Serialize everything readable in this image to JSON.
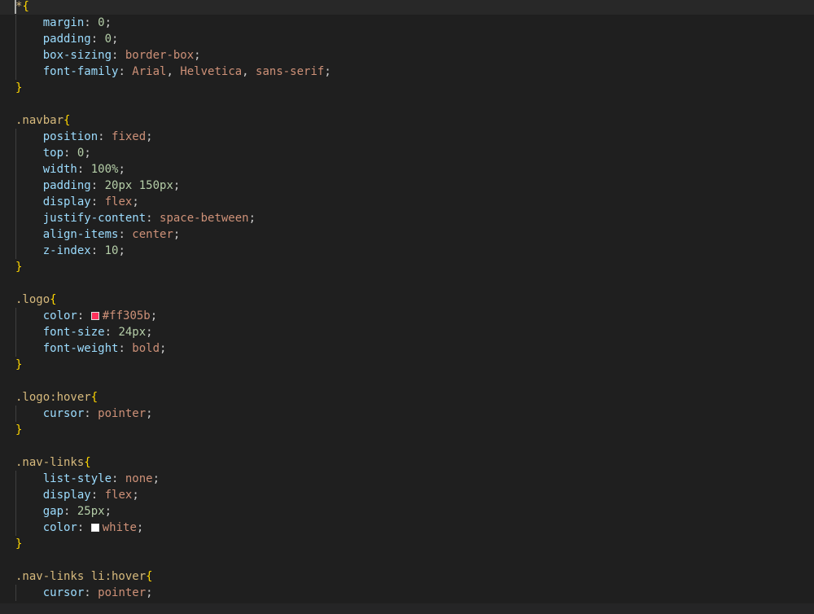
{
  "colors": {
    "background": "#1f1f1f",
    "current_line": "#282828",
    "selector": "#d7ba7d",
    "brace": "#ffd700",
    "property": "#9cdcfe",
    "value": "#ce9178",
    "number": "#b5cea8",
    "punctuation": "#cccccc"
  },
  "lines": [
    [
      {
        "t": "*",
        "c": "selector"
      },
      {
        "t": "{",
        "c": "brace"
      }
    ],
    [
      {
        "t": "    "
      },
      {
        "t": "margin",
        "c": "property"
      },
      {
        "t": ": "
      },
      {
        "t": "0",
        "c": "number"
      },
      {
        "t": ";"
      }
    ],
    [
      {
        "t": "    "
      },
      {
        "t": "padding",
        "c": "property"
      },
      {
        "t": ": "
      },
      {
        "t": "0",
        "c": "number"
      },
      {
        "t": ";"
      }
    ],
    [
      {
        "t": "    "
      },
      {
        "t": "box-sizing",
        "c": "property"
      },
      {
        "t": ": "
      },
      {
        "t": "border-box",
        "c": "value"
      },
      {
        "t": ";"
      }
    ],
    [
      {
        "t": "    "
      },
      {
        "t": "font-family",
        "c": "property"
      },
      {
        "t": ": "
      },
      {
        "t": "Arial",
        "c": "value"
      },
      {
        "t": ", "
      },
      {
        "t": "Helvetica",
        "c": "value"
      },
      {
        "t": ", "
      },
      {
        "t": "sans-serif",
        "c": "value"
      },
      {
        "t": ";"
      }
    ],
    [
      {
        "t": "}",
        "c": "brace"
      }
    ],
    [],
    [
      {
        "t": ".navbar",
        "c": "selector"
      },
      {
        "t": "{",
        "c": "brace"
      }
    ],
    [
      {
        "t": "    "
      },
      {
        "t": "position",
        "c": "property"
      },
      {
        "t": ": "
      },
      {
        "t": "fixed",
        "c": "value"
      },
      {
        "t": ";"
      }
    ],
    [
      {
        "t": "    "
      },
      {
        "t": "top",
        "c": "property"
      },
      {
        "t": ": "
      },
      {
        "t": "0",
        "c": "number"
      },
      {
        "t": ";"
      }
    ],
    [
      {
        "t": "    "
      },
      {
        "t": "width",
        "c": "property"
      },
      {
        "t": ": "
      },
      {
        "t": "100%",
        "c": "number"
      },
      {
        "t": ";"
      }
    ],
    [
      {
        "t": "    "
      },
      {
        "t": "padding",
        "c": "property"
      },
      {
        "t": ": "
      },
      {
        "t": "20px",
        "c": "number"
      },
      {
        "t": " "
      },
      {
        "t": "150px",
        "c": "number"
      },
      {
        "t": ";"
      }
    ],
    [
      {
        "t": "    "
      },
      {
        "t": "display",
        "c": "property"
      },
      {
        "t": ": "
      },
      {
        "t": "flex",
        "c": "value"
      },
      {
        "t": ";"
      }
    ],
    [
      {
        "t": "    "
      },
      {
        "t": "justify-content",
        "c": "property"
      },
      {
        "t": ": "
      },
      {
        "t": "space-between",
        "c": "value"
      },
      {
        "t": ";"
      }
    ],
    [
      {
        "t": "    "
      },
      {
        "t": "align-items",
        "c": "property"
      },
      {
        "t": ": "
      },
      {
        "t": "center",
        "c": "value"
      },
      {
        "t": ";"
      }
    ],
    [
      {
        "t": "    "
      },
      {
        "t": "z-index",
        "c": "property"
      },
      {
        "t": ": "
      },
      {
        "t": "10",
        "c": "number"
      },
      {
        "t": ";"
      }
    ],
    [
      {
        "t": "}",
        "c": "brace"
      }
    ],
    [],
    [
      {
        "t": ".logo",
        "c": "selector"
      },
      {
        "t": "{",
        "c": "brace"
      }
    ],
    [
      {
        "t": "    "
      },
      {
        "t": "color",
        "c": "property"
      },
      {
        "t": ": "
      },
      {
        "swatch": "#ff305b"
      },
      {
        "t": "#ff305b",
        "c": "value"
      },
      {
        "t": ";"
      }
    ],
    [
      {
        "t": "    "
      },
      {
        "t": "font-size",
        "c": "property"
      },
      {
        "t": ": "
      },
      {
        "t": "24px",
        "c": "number"
      },
      {
        "t": ";"
      }
    ],
    [
      {
        "t": "    "
      },
      {
        "t": "font-weight",
        "c": "property"
      },
      {
        "t": ": "
      },
      {
        "t": "bold",
        "c": "value"
      },
      {
        "t": ";"
      }
    ],
    [
      {
        "t": "}",
        "c": "brace"
      }
    ],
    [],
    [
      {
        "t": ".logo:hover",
        "c": "selector"
      },
      {
        "t": "{",
        "c": "brace"
      }
    ],
    [
      {
        "t": "    "
      },
      {
        "t": "cursor",
        "c": "property"
      },
      {
        "t": ": "
      },
      {
        "t": "pointer",
        "c": "value"
      },
      {
        "t": ";"
      }
    ],
    [
      {
        "t": "}",
        "c": "brace"
      }
    ],
    [],
    [
      {
        "t": ".nav-links",
        "c": "selector"
      },
      {
        "t": "{",
        "c": "brace"
      }
    ],
    [
      {
        "t": "    "
      },
      {
        "t": "list-style",
        "c": "property"
      },
      {
        "t": ": "
      },
      {
        "t": "none",
        "c": "value"
      },
      {
        "t": ";"
      }
    ],
    [
      {
        "t": "    "
      },
      {
        "t": "display",
        "c": "property"
      },
      {
        "t": ": "
      },
      {
        "t": "flex",
        "c": "value"
      },
      {
        "t": ";"
      }
    ],
    [
      {
        "t": "    "
      },
      {
        "t": "gap",
        "c": "property"
      },
      {
        "t": ": "
      },
      {
        "t": "25px",
        "c": "number"
      },
      {
        "t": ";"
      }
    ],
    [
      {
        "t": "    "
      },
      {
        "t": "color",
        "c": "property"
      },
      {
        "t": ": "
      },
      {
        "swatch": "#ffffff"
      },
      {
        "t": "white",
        "c": "value"
      },
      {
        "t": ";"
      }
    ],
    [
      {
        "t": "}",
        "c": "brace"
      }
    ],
    [],
    [
      {
        "t": ".nav-links li:hover",
        "c": "selector"
      },
      {
        "t": "{",
        "c": "brace"
      }
    ],
    [
      {
        "t": "    "
      },
      {
        "t": "cursor",
        "c": "property"
      },
      {
        "t": ": "
      },
      {
        "t": "pointer",
        "c": "value"
      },
      {
        "t": ";"
      }
    ]
  ],
  "guide_lines": [
    1,
    2,
    3,
    4,
    8,
    9,
    10,
    11,
    12,
    13,
    14,
    15,
    19,
    20,
    21,
    25,
    29,
    30,
    31,
    32,
    36
  ]
}
